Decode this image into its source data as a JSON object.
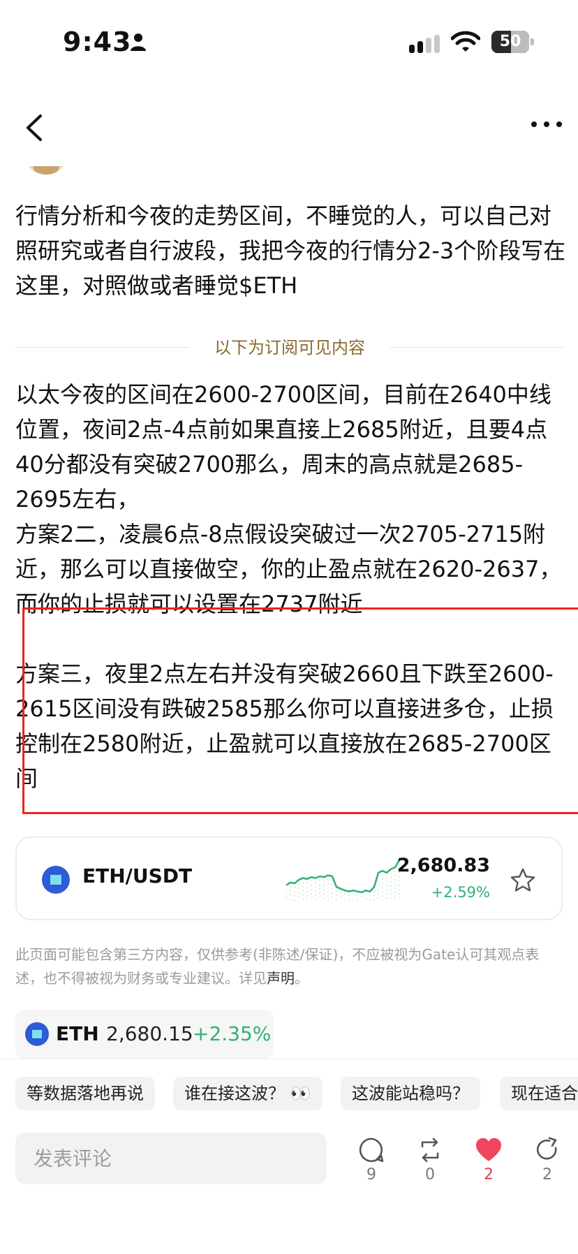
{
  "status_bar": {
    "time": "9:43",
    "battery": "50"
  },
  "post": {
    "intro": "行情分析和今夜的走势区间，不睡觉的人，可以自己对照研究或者自行波段，我把今夜的行情分2-3个阶段写在这里，对照做或者睡觉$ETH",
    "subscriber_divider": "以下为订阅可见内容",
    "paragraphs": [
      "以太今夜的区间在2600-2700区间，目前在2640中线位置，夜间2点-4点前如果直接上2685附近，且要4点40分都没有突破2700那么，周末的高点就是2685-2695左右，",
      "方案2二，凌晨6点-8点假设突破过一次2705-2715附近，那么可以直接做空，你的止盈点就在2620-2637，而你的止损就可以设置在2737附近",
      "方案三，夜里2点左右并没有突破2660且下跌至2600-2615区间没有跌破2585那么你可以直接进多仓，止损控制在2580附近，止盈就可以直接放在2685-2700区间"
    ]
  },
  "ticker_card": {
    "pair": "ETH/USDT",
    "price": "2,680.83",
    "change": "+2.59%",
    "change_color": "#2fb173",
    "sparkline": [
      2652,
      2655,
      2654,
      2658,
      2660,
      2659,
      2661,
      2660,
      2662,
      2661,
      2663,
      2662,
      2650,
      2648,
      2646,
      2645,
      2646,
      2645,
      2644,
      2646,
      2645,
      2650,
      2666,
      2668,
      2666,
      2670,
      2672,
      2680
    ]
  },
  "disclaimer": {
    "text": "此页面可能包含第三方内容，仅供参考(非陈述/保证)，不应被视为Gate认可其观点表述，也不得被视为财务或专业建议。详见",
    "link": "声明",
    "end": "。"
  },
  "coin_chip": {
    "symbol": "ETH",
    "price": "2,680.15",
    "change": "+2.35%"
  },
  "quick_replies": [
    "等数据落地再说",
    "谁在接这波？ 👀",
    "这波能站稳吗？",
    "现在适合"
  ],
  "comment": {
    "placeholder": "发表评论"
  },
  "actions": {
    "comments": "9",
    "reposts": "0",
    "likes": "2",
    "shares": "2"
  }
}
